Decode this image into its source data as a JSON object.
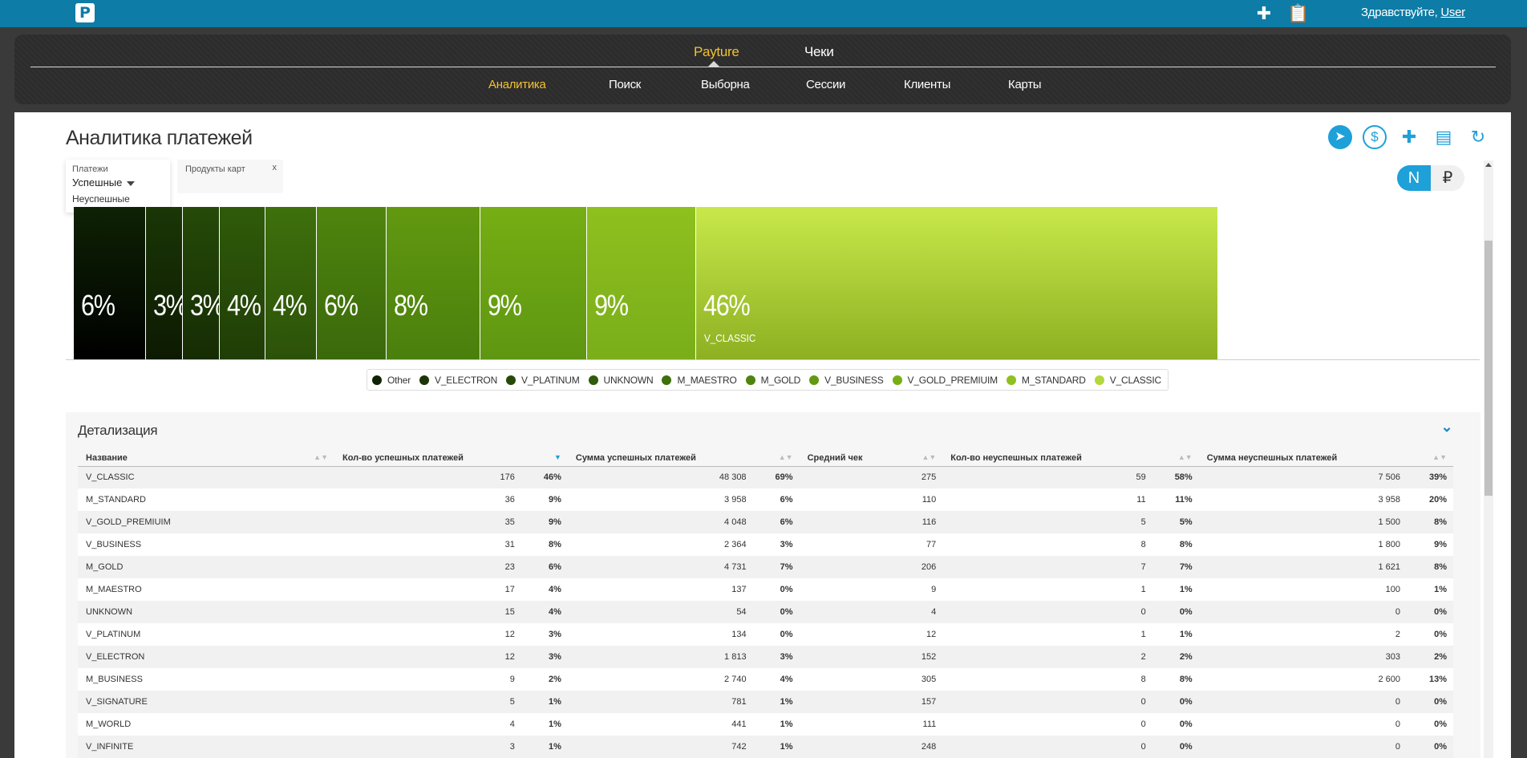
{
  "header": {
    "logo_letter": "P",
    "icons": [
      "doctor-plus-icon",
      "clipboard-icon"
    ],
    "greeting_prefix": "Здравствуйте,",
    "user_name": "User"
  },
  "nav": {
    "top": [
      {
        "label": "Payture",
        "active": true
      },
      {
        "label": "Чеки",
        "active": false
      }
    ],
    "sub": [
      {
        "label": "Аналитика",
        "active": true
      },
      {
        "label": "Поиск",
        "active": false
      },
      {
        "label": "Выборна",
        "active": false
      },
      {
        "label": "Сессии",
        "active": false
      },
      {
        "label": "Клиенты",
        "active": false
      },
      {
        "label": "Карты",
        "active": false
      }
    ]
  },
  "page": {
    "title": "Аналитика платежей",
    "toolbar_icons": [
      "send-icon",
      "dollar-icon",
      "medical-dollar-icon",
      "receipt-icon",
      "refresh-icon"
    ]
  },
  "filters": {
    "payments": {
      "label": "Платежи",
      "selected": "Успешные",
      "options": [
        "Неуспешные"
      ]
    },
    "products": {
      "label": "Продукты карт",
      "clear": "x"
    }
  },
  "toggle": {
    "count_label": "N",
    "sum_label": "₽",
    "selected": "N"
  },
  "chart_data": {
    "type": "treemap",
    "items": [
      {
        "name": "Other",
        "percent": 6,
        "color": "#0e2204"
      },
      {
        "name": "V_ELECTRON",
        "percent": 3,
        "color": "#1a3606"
      },
      {
        "name": "V_PLATINUM",
        "percent": 3,
        "color": "#254a08"
      },
      {
        "name": "UNKNOWN",
        "percent": 4,
        "color": "#305b0a"
      },
      {
        "name": "M_MAESTRO",
        "percent": 4,
        "color": "#3e700c"
      },
      {
        "name": "M_GOLD",
        "percent": 6,
        "color": "#4f850e"
      },
      {
        "name": "V_BUSINESS",
        "percent": 8,
        "color": "#629910"
      },
      {
        "name": "V_GOLD_PREMIUIM",
        "percent": 9,
        "color": "#76ae14"
      },
      {
        "name": "M_STANDARD",
        "percent": 9,
        "color": "#8ec01e"
      },
      {
        "name": "V_CLASSIC",
        "percent": 46,
        "color": "#b2d83a"
      }
    ],
    "labeled_tile": "V_CLASSIC",
    "legend_position": "bottom"
  },
  "details": {
    "title": "Детализация",
    "columns": [
      "Название",
      "Кол-во успешных платежей",
      "Сумма успешных платежей",
      "Средний чек",
      "Кол-во неуспешных платежей",
      "Сумма неуспешных платежей"
    ],
    "sorted_column": 1,
    "rows": [
      {
        "name": "V_CLASSIC",
        "succ_count": "176",
        "succ_count_pct": "46%",
        "succ_sum": "48 308",
        "succ_sum_pct": "69%",
        "avg": "275",
        "fail_count": "59",
        "fail_count_pct": "58%",
        "fail_sum": "7 506",
        "fail_sum_pct": "39%"
      },
      {
        "name": "M_STANDARD",
        "succ_count": "36",
        "succ_count_pct": "9%",
        "succ_sum": "3 958",
        "succ_sum_pct": "6%",
        "avg": "110",
        "fail_count": "11",
        "fail_count_pct": "11%",
        "fail_sum": "3 958",
        "fail_sum_pct": "20%"
      },
      {
        "name": "V_GOLD_PREMIUIM",
        "succ_count": "35",
        "succ_count_pct": "9%",
        "succ_sum": "4 048",
        "succ_sum_pct": "6%",
        "avg": "116",
        "fail_count": "5",
        "fail_count_pct": "5%",
        "fail_sum": "1 500",
        "fail_sum_pct": "8%"
      },
      {
        "name": "V_BUSINESS",
        "succ_count": "31",
        "succ_count_pct": "8%",
        "succ_sum": "2 364",
        "succ_sum_pct": "3%",
        "avg": "77",
        "fail_count": "8",
        "fail_count_pct": "8%",
        "fail_sum": "1 800",
        "fail_sum_pct": "9%"
      },
      {
        "name": "M_GOLD",
        "succ_count": "23",
        "succ_count_pct": "6%",
        "succ_sum": "4 731",
        "succ_sum_pct": "7%",
        "avg": "206",
        "fail_count": "7",
        "fail_count_pct": "7%",
        "fail_sum": "1 621",
        "fail_sum_pct": "8%"
      },
      {
        "name": "M_MAESTRO",
        "succ_count": "17",
        "succ_count_pct": "4%",
        "succ_sum": "137",
        "succ_sum_pct": "0%",
        "avg": "9",
        "fail_count": "1",
        "fail_count_pct": "1%",
        "fail_sum": "100",
        "fail_sum_pct": "1%"
      },
      {
        "name": "UNKNOWN",
        "succ_count": "15",
        "succ_count_pct": "4%",
        "succ_sum": "54",
        "succ_sum_pct": "0%",
        "avg": "4",
        "fail_count": "0",
        "fail_count_pct": "0%",
        "fail_sum": "0",
        "fail_sum_pct": "0%"
      },
      {
        "name": "V_PLATINUM",
        "succ_count": "12",
        "succ_count_pct": "3%",
        "succ_sum": "134",
        "succ_sum_pct": "0%",
        "avg": "12",
        "fail_count": "1",
        "fail_count_pct": "1%",
        "fail_sum": "2",
        "fail_sum_pct": "0%"
      },
      {
        "name": "V_ELECTRON",
        "succ_count": "12",
        "succ_count_pct": "3%",
        "succ_sum": "1 813",
        "succ_sum_pct": "3%",
        "avg": "152",
        "fail_count": "2",
        "fail_count_pct": "2%",
        "fail_sum": "303",
        "fail_sum_pct": "2%"
      },
      {
        "name": "M_BUSINESS",
        "succ_count": "9",
        "succ_count_pct": "2%",
        "succ_sum": "2 740",
        "succ_sum_pct": "4%",
        "avg": "305",
        "fail_count": "8",
        "fail_count_pct": "8%",
        "fail_sum": "2 600",
        "fail_sum_pct": "13%"
      },
      {
        "name": "V_SIGNATURE",
        "succ_count": "5",
        "succ_count_pct": "1%",
        "succ_sum": "781",
        "succ_sum_pct": "1%",
        "avg": "157",
        "fail_count": "0",
        "fail_count_pct": "0%",
        "fail_sum": "0",
        "fail_sum_pct": "0%"
      },
      {
        "name": "M_WORLD",
        "succ_count": "4",
        "succ_count_pct": "1%",
        "succ_sum": "441",
        "succ_sum_pct": "1%",
        "avg": "111",
        "fail_count": "0",
        "fail_count_pct": "0%",
        "fail_sum": "0",
        "fail_sum_pct": "0%"
      },
      {
        "name": "V_INFINITE",
        "succ_count": "3",
        "succ_count_pct": "1%",
        "succ_sum": "742",
        "succ_sum_pct": "1%",
        "avg": "248",
        "fail_count": "0",
        "fail_count_pct": "0%",
        "fail_sum": "0",
        "fail_sum_pct": "0%"
      }
    ]
  }
}
